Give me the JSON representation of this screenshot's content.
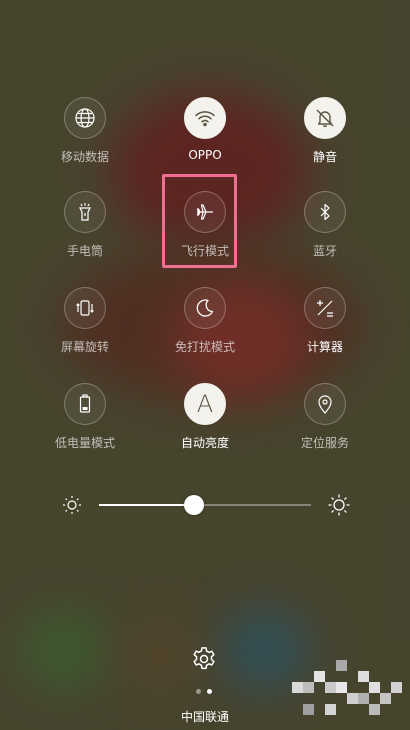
{
  "tiles": [
    {
      "label": "移动数据",
      "icon": "globe-icon",
      "on": false
    },
    {
      "label": "OPPO",
      "icon": "wifi-icon",
      "on": true
    },
    {
      "label": "静音",
      "icon": "bell-off-icon",
      "on": true
    },
    {
      "label": "手电筒",
      "icon": "flashlight-icon",
      "on": false
    },
    {
      "label": "飞行模式",
      "icon": "airplane-icon",
      "on": false
    },
    {
      "label": "蓝牙",
      "icon": "bluetooth-icon",
      "on": false
    },
    {
      "label": "屏幕旋转",
      "icon": "rotate-screen-icon",
      "on": false
    },
    {
      "label": "免打扰模式",
      "icon": "moon-icon",
      "on": false
    },
    {
      "label": "计算器",
      "icon": "calculator-icon",
      "on": false
    },
    {
      "label": "低电量模式",
      "icon": "battery-icon",
      "on": false
    },
    {
      "label": "自动亮度",
      "icon": "auto-brightness-icon",
      "glyph": "A",
      "on": true
    },
    {
      "label": "定位服务",
      "icon": "location-pin-icon",
      "on": false
    }
  ],
  "brightness": {
    "level": 0.45,
    "low_icon": "sun-small-icon",
    "high_icon": "sun-large-icon"
  },
  "footer": {
    "settings_icon": "gear-icon",
    "page_count": 2,
    "active_page": 2,
    "carrier": "中国联通"
  },
  "colors": {
    "highlight": "#ef6f92",
    "tile_on": "#f4f2ec"
  }
}
